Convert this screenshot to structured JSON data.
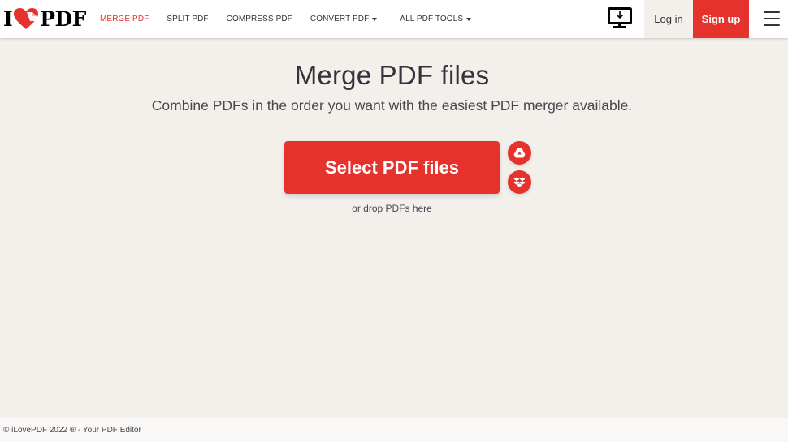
{
  "header": {
    "logo": {
      "left_text": "I",
      "right_text": "PDF",
      "icon": "heart-pdf-icon"
    },
    "nav": [
      {
        "label": "MERGE PDF",
        "active": true,
        "dropdown": false
      },
      {
        "label": "SPLIT PDF",
        "active": false,
        "dropdown": false
      },
      {
        "label": "COMPRESS PDF",
        "active": false,
        "dropdown": false
      },
      {
        "label": "CONVERT PDF",
        "active": false,
        "dropdown": true
      },
      {
        "label": "ALL PDF TOOLS",
        "active": false,
        "dropdown": true
      }
    ],
    "desktop_icon": "desktop-download-icon",
    "login_label": "Log in",
    "signup_label": "Sign up",
    "menu_icon": "hamburger-menu-icon"
  },
  "main": {
    "title": "Merge PDF files",
    "subtitle": "Combine PDFs in the order you want with the easiest PDF merger available.",
    "select_button_label": "Select PDF files",
    "cloud_sources": [
      {
        "name": "Google Drive",
        "icon": "google-drive-icon"
      },
      {
        "name": "Dropbox",
        "icon": "dropbox-icon"
      }
    ],
    "drop_hint": "or drop PDFs here"
  },
  "footer": {
    "text": "© iLovePDF 2022 ® - Your PDF Editor"
  },
  "colors": {
    "brand_red": "#e5322d",
    "background": "#f3f0ec",
    "text": "#33333b"
  }
}
